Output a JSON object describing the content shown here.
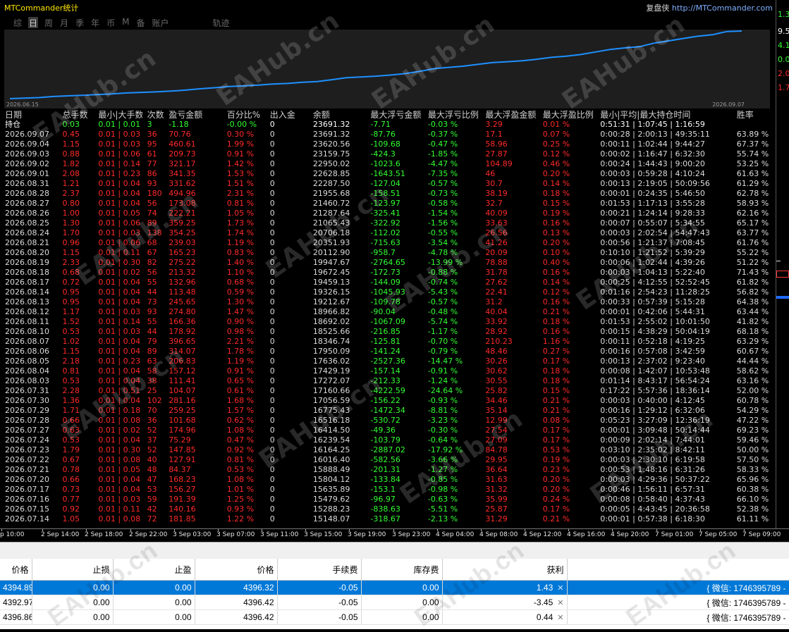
{
  "indicator": {
    "title": "MTCommander统计",
    "brand_prefix": "复盘侠",
    "brand_url": "http://MTCommander.com"
  },
  "tabs": [
    {
      "label": "综",
      "active": false
    },
    {
      "label": "日",
      "active": true
    },
    {
      "label": "周",
      "active": false
    },
    {
      "label": "月",
      "active": false
    },
    {
      "label": "季",
      "active": false
    },
    {
      "label": "年",
      "active": false
    },
    {
      "label": "币",
      "active": false
    },
    {
      "label": "M",
      "active": false
    },
    {
      "label": "备",
      "active": false
    },
    {
      "label": "账户",
      "active": false
    },
    {
      "label": "轨迹",
      "active": false
    }
  ],
  "equity": {
    "start_date": "2026.06.15",
    "end_date": "2026.09.07",
    "line_color": "#1e90ff",
    "values": [
      14080,
      14150,
      14230,
      14390,
      14480,
      14560,
      14650,
      14760,
      14890,
      14970,
      15040,
      15148,
      15288,
      15479,
      15635,
      15804,
      15888,
      16016,
      16164,
      16239,
      16414,
      16516,
      16775,
      17056,
      17160,
      17272,
      17429,
      17636,
      17950,
      18346,
      18525,
      18692,
      18966,
      19212,
      19326,
      19459,
      19672,
      19947,
      20112,
      20351,
      20706,
      21065,
      21287,
      21460,
      21955,
      22287,
      22628,
      22950,
      23159,
      23620,
      23691
    ]
  },
  "watermark": "EAHub.cn",
  "stats": {
    "headers": [
      "日期",
      "总手数",
      "最小|大手数",
      "次数",
      "盈亏金额",
      "百分比%",
      "出入金",
      "余额",
      "最大浮亏金额",
      "最大浮亏比例",
      "最大浮盈金额",
      "最大浮盈比例",
      "最小|平均|最大持仓时间",
      "胜率"
    ],
    "holding": {
      "label": "持仓",
      "lots": "0.03",
      "minmax": "0.01 | 0.01",
      "count": "3",
      "pnl": "-1.18",
      "pct": "-0.00 %",
      "flow": "0",
      "balance": "23691.32",
      "max_dd": "-7.71",
      "max_dd_pct": "-0.03 %",
      "max_fp": "3.29",
      "max_fp_pct": "0.01 %",
      "hold_time": "0:51:31 | 1:07:45 | 1:16:59",
      "winrate": ""
    },
    "rows": [
      [
        "2026.09.07",
        "0.45",
        "0.01 | 0.03",
        "36",
        "70.76",
        "0.30 %",
        "0",
        "23691.32",
        "-87.76",
        "-0.37 %",
        "17.1",
        "0.07 %",
        "0:00:28 | 2:00:13 | 49:35:11",
        "63.89 %"
      ],
      [
        "2026.09.04",
        "1.15",
        "0.01 | 0.03",
        "95",
        "460.61",
        "1.99 %",
        "0",
        "23620.56",
        "-109.68",
        "-0.47 %",
        "58.96",
        "0.25 %",
        "0:00:11 | 1:02:44 | 9:44:27",
        "67.37 %"
      ],
      [
        "2026.09.03",
        "0.88",
        "0.01 | 0.06",
        "61",
        "209.73",
        "0.91 %",
        "0",
        "23159.75",
        "-424.3",
        "-1.85 %",
        "27.87",
        "0.12 %",
        "0:00:02 | 1:16:47 | 6:32:30",
        "55.74 %"
      ],
      [
        "2026.09.02",
        "1.82",
        "0.01 | 0.14",
        "77",
        "321.17",
        "1.42 %",
        "0",
        "22950.02",
        "-1023.6",
        "-4.47 %",
        "104.89",
        "0.46 %",
        "0:00:24 | 1:44:43 | 9:00:20",
        "53.25 %"
      ],
      [
        "2026.09.01",
        "2.08",
        "0.01 | 0.23",
        "86",
        "341.35",
        "1.53 %",
        "0",
        "22628.85",
        "-1643.51",
        "-7.35 %",
        "46",
        "0.20 %",
        "0:00:03 | 0:59:28 | 4:10:24",
        "61.63 %"
      ],
      [
        "2026.08.31",
        "1.21",
        "0.01 | 0.04",
        "93",
        "331.62",
        "1.51 %",
        "0",
        "22287.50",
        "-127.04",
        "-0.57 %",
        "30.7",
        "0.14 %",
        "0:00:13 | 2:19:05 | 50:09:56",
        "61.29 %"
      ],
      [
        "2026.08.28",
        "2.37",
        "0.01 | 0.04",
        "180",
        "494.96",
        "2.31 %",
        "0",
        "21955.68",
        "-158.51",
        "-0.73 %",
        "38.19",
        "0.18 %",
        "0:00:01 | 0:24:35 | 5:46:50",
        "62.78 %"
      ],
      [
        "2026.08.27",
        "0.80",
        "0.01 | 0.04",
        "56",
        "173.08",
        "0.81 %",
        "0",
        "21460.72",
        "-123.97",
        "-0.58 %",
        "32.7",
        "0.15 %",
        "0:01:53 | 1:17:13 | 3:55:28",
        "58.93 %"
      ],
      [
        "2026.08.26",
        "1.00",
        "0.01 | 0.05",
        "74",
        "222.21",
        "1.05 %",
        "0",
        "21287.64",
        "-325.41",
        "-1.54 %",
        "40.09",
        "0.19 %",
        "0:00:21 | 1:24:14 | 9:28:33",
        "62.16 %"
      ],
      [
        "2026.08.25",
        "1.30",
        "0.01 | 0.06",
        "89",
        "359.25",
        "1.73 %",
        "0",
        "21065.43",
        "-322.92",
        "-1.56 %",
        "33.63",
        "0.16 %",
        "0:00:07 | 0:55:07 | 5:34:55",
        "65.17 %"
      ],
      [
        "2026.08.24",
        "1.70",
        "0.01 | 0.03",
        "138",
        "354.25",
        "1.74 %",
        "0",
        "20706.18",
        "-112.02",
        "-0.55 %",
        "26.56",
        "0.13 %",
        "0:00:03 | 2:02:54 | 54:47:43",
        "63.77 %"
      ],
      [
        "2026.08.21",
        "0.96",
        "0.01 | 0.06",
        "68",
        "239.03",
        "1.19 %",
        "0",
        "20351.93",
        "-715.63",
        "-3.54 %",
        "41.26",
        "0.20 %",
        "0:00:56 | 1:21:37 | 7:08:45",
        "61.76 %"
      ],
      [
        "2026.08.20",
        "1.15",
        "0.01 | 0.11",
        "67",
        "165.23",
        "0.83 %",
        "0",
        "20112.90",
        "-958.7",
        "-4.78 %",
        "20.09",
        "0.10 %",
        "0:10:10 | 1:21:52 | 5:39:29",
        "55.22 %"
      ],
      [
        "2026.08.19",
        "2.33",
        "0.01 | 0.30",
        "82",
        "275.22",
        "1.40 %",
        "0",
        "19947.67",
        "-2764.65",
        "-13.99 %",
        "78.88",
        "0.40 %",
        "0:00:06 | 1:02:44 | 4:39:26",
        "51.22 %"
      ],
      [
        "2026.08.18",
        "0.68",
        "0.01 | 0.02",
        "56",
        "213.32",
        "1.10 %",
        "0",
        "19672.45",
        "-172.73",
        "-0.88 %",
        "31.78",
        "0.16 %",
        "0:00:03 | 1:04:13 | 5:22:40",
        "71.43 %"
      ],
      [
        "2026.08.17",
        "0.72",
        "0.01 | 0.04",
        "55",
        "132.96",
        "0.68 %",
        "0",
        "19459.13",
        "-144.09",
        "-0.74 %",
        "27.62",
        "0.14 %",
        "0:00:25 | 4:12:55 | 52:52:45",
        "61.82 %"
      ],
      [
        "2026.08.14",
        "0.95",
        "0.01 | 0.04",
        "44",
        "113.48",
        "0.59 %",
        "0",
        "19326.15",
        "-1045.93",
        "-5.43 %",
        "22.41",
        "0.12 %",
        "0:01:16 | 2:54:23 | 11:28:25",
        "56.82 %"
      ],
      [
        "2026.08.13",
        "0.95",
        "0.01 | 0.04",
        "73",
        "245.65",
        "1.30 %",
        "0",
        "19212.67",
        "-109.78",
        "-0.57 %",
        "31.2",
        "0.16 %",
        "0:00:33 | 0:57:39 | 5:15:28",
        "64.38 %"
      ],
      [
        "2026.08.12",
        "1.17",
        "0.01 | 0.03",
        "93",
        "274.80",
        "1.47 %",
        "0",
        "18966.82",
        "-90.04",
        "-0.48 %",
        "40.04",
        "0.21 %",
        "0:00:01 | 0:42:06 | 5:44:31",
        "63.44 %"
      ],
      [
        "2026.08.11",
        "1.52",
        "0.01 | 0.14",
        "55",
        "166.36",
        "0.90 %",
        "0",
        "18692.02",
        "-1067.09",
        "-5.74 %",
        "33.92",
        "0.18 %",
        "0:01:53 | 2:55:02 | 10:01:50",
        "41.82 %"
      ],
      [
        "2026.08.10",
        "0.53",
        "0.01 | 0.03",
        "44",
        "178.92",
        "0.98 %",
        "0",
        "18525.66",
        "-216.85",
        "-1.17 %",
        "28.92",
        "0.16 %",
        "0:00:15 | 4:38:29 | 50:04:19",
        "68.18 %"
      ],
      [
        "2026.08.07",
        "1.02",
        "0.01 | 0.04",
        "79",
        "396.65",
        "2.21 %",
        "0",
        "18346.74",
        "-125.81",
        "-0.70 %",
        "210.23",
        "1.16 %",
        "0:00:11 | 0:52:18 | 4:19:25",
        "63.29 %"
      ],
      [
        "2026.08.06",
        "1.15",
        "0.01 | 0.04",
        "89",
        "314.07",
        "1.78 %",
        "0",
        "17950.09",
        "-141.24",
        "-0.79 %",
        "48.46",
        "0.27 %",
        "0:00:16 | 0:57:08 | 3:42:59",
        "60.67 %"
      ],
      [
        "2026.08.05",
        "2.18",
        "0.01 | 0.23",
        "63",
        "206.83",
        "1.19 %",
        "0",
        "17636.02",
        "-2527.36",
        "-14.47 %",
        "30.26",
        "0.17 %",
        "0:00:13 | 2:37:02 | 9:23:40",
        "44.44 %"
      ],
      [
        "2026.08.04",
        "0.81",
        "0.01 | 0.04",
        "58",
        "157.12",
        "0.91 %",
        "0",
        "17429.19",
        "-157.14",
        "-0.91 %",
        "30.62",
        "0.18 %",
        "0:00:08 | 1:42:07 | 10:53:48",
        "58.62 %"
      ],
      [
        "2026.08.03",
        "0.53",
        "0.01 | 0.04",
        "38",
        "111.41",
        "0.65 %",
        "0",
        "17272.07",
        "-212.33",
        "-1.24 %",
        "30.55",
        "0.18 %",
        "0:01:14 | 8:43:17 | 56:54:24",
        "63.16 %"
      ],
      [
        "2026.07.31",
        "2.28",
        "0.01 | 0.51",
        "25",
        "104.07",
        "0.61 %",
        "0",
        "17160.66",
        "-4222.59",
        "-24.64 %",
        "25.82",
        "0.15 %",
        "0:17:22 | 5:57:36 | 18:36:14",
        "52.00 %"
      ],
      [
        "2026.07.30",
        "1.36",
        "0.01 | 0.04",
        "102",
        "281.16",
        "1.68 %",
        "0",
        "17056.59",
        "-156.22",
        "-0.93 %",
        "34.46",
        "0.21 %",
        "0:00:03 | 0:40:00 | 4:12:45",
        "60.78 %"
      ],
      [
        "2026.07.29",
        "1.71",
        "0.01 | 0.18",
        "70",
        "259.25",
        "1.57 %",
        "0",
        "16775.43",
        "-1472.34",
        "-8.81 %",
        "35.14",
        "0.21 %",
        "0:00:16 | 1:29:12 | 6:32:06",
        "54.29 %"
      ],
      [
        "2026.07.28",
        "0.66",
        "0.01 | 0.08",
        "36",
        "101.68",
        "0.62 %",
        "0",
        "16516.18",
        "-530.72",
        "-3.23 %",
        "12.99",
        "0.08 %",
        "0:05:23 | 3:27:09 | 12:36:19",
        "47.22 %"
      ],
      [
        "2026.07.27",
        "0.63",
        "0.01 | 0.02",
        "52",
        "174.96",
        "1.08 %",
        "0",
        "16414.50",
        "-49.36",
        "-0.30 %",
        "27.54",
        "0.17 %",
        "0:00:01 | 3:09:48 | 50:14:44",
        "69.23 %"
      ],
      [
        "2026.07.24",
        "0.53",
        "0.01 | 0.04",
        "37",
        "75.29",
        "0.47 %",
        "0",
        "16239.54",
        "-103.79",
        "-0.64 %",
        "27.09",
        "0.17 %",
        "0:00:09 | 2:02:14 | 7:44:01",
        "59.46 %"
      ],
      [
        "2026.07.23",
        "1.79",
        "0.01 | 0.30",
        "52",
        "147.85",
        "0.92 %",
        "0",
        "16164.25",
        "-2887.02",
        "-17.92 %",
        "84.78",
        "0.53 %",
        "0:03:10 | 2:35:02 | 8:42:11",
        "50.00 %"
      ],
      [
        "2026.07.22",
        "0.67",
        "0.01 | 0.08",
        "40",
        "127.91",
        "0.81 %",
        "0",
        "16016.40",
        "-582.56",
        "-3.66 %",
        "29.95",
        "0.19 %",
        "0:00:03 | 2:30:10 | 6:19:58",
        "57.50 %"
      ],
      [
        "2026.07.21",
        "0.78",
        "0.01 | 0.05",
        "48",
        "84.37",
        "0.53 %",
        "0",
        "15888.49",
        "-201.31",
        "-1.27 %",
        "36.64",
        "0.23 %",
        "0:00:53 | 1:48:16 | 6:31:26",
        "58.33 %"
      ],
      [
        "2026.07.20",
        "0.66",
        "0.01 | 0.04",
        "47",
        "168.23",
        "1.08 %",
        "0",
        "15804.12",
        "-133.84",
        "-0.85 %",
        "31.63",
        "0.20 %",
        "0:00:03 | 4:29:36 | 50:37:22",
        "65.96 %"
      ],
      [
        "2026.07.17",
        "0.73",
        "0.01 | 0.04",
        "53",
        "156.27",
        "1.01 %",
        "0",
        "15635.89",
        "-153.1",
        "-0.98 %",
        "31.32",
        "0.20 %",
        "0:00:46 | 1:56:11 | 6:57:31",
        "60.38 %"
      ],
      [
        "2026.07.16",
        "0.77",
        "0.01 | 0.03",
        "59",
        "191.39",
        "1.25 %",
        "0",
        "15479.62",
        "-96.97",
        "-0.63 %",
        "35.99",
        "0.24 %",
        "0:00:08 | 0:58:40 | 4:37:43",
        "66.10 %"
      ],
      [
        "2026.07.15",
        "0.92",
        "0.01 | 0.11",
        "42",
        "140.16",
        "0.93 %",
        "0",
        "15288.23",
        "-838.63",
        "-5.51 %",
        "25.87",
        "0.17 %",
        "0:00:05 | 4:43:45 | 20:36:58",
        "52.38 %"
      ],
      [
        "2026.07.14",
        "1.05",
        "0.01 | 0.08",
        "72",
        "181.85",
        "1.22 %",
        "0",
        "15148.07",
        "-318.67",
        "-2.13 %",
        "31.29",
        "0.21 %",
        "0:00:01 | 0:57:38 | 6:18:30",
        "61.11 %"
      ]
    ]
  },
  "right_axis": [
    {
      "label": "1.3",
      "color": "#33ff33"
    },
    {
      "label": "9.5",
      "color": "#ffffff"
    },
    {
      "label": "4.1",
      "color": "#33ff33"
    },
    {
      "label": "0.0",
      "color": "#33ff33"
    },
    {
      "label": "2.0",
      "color": "#ff2a2a"
    },
    {
      "label": "1.7",
      "color": "#ff2a2a"
    }
  ],
  "time_axis": [
    "p 10:00",
    "2 Sep 14:00",
    "2 Sep 18:00",
    "2 Sep 22:00",
    "3 Sep 03:00",
    "3 Sep 07:00",
    "3 Sep 11:00",
    "3 Sep 15:00",
    "3 Sep 19:00",
    "3 Sep 23:00",
    "4 Sep 04:00",
    "4 Sep 08:00",
    "4 Sep 12:00",
    "4 Sep 16:00",
    "4 Sep 20:00",
    "7 Sep 01:00",
    "7 Sep 05:00",
    "7 Sep 09:00"
  ],
  "orders": {
    "headers": [
      "价格",
      "止损",
      "止盈",
      "价格",
      "手续费",
      "库存费",
      "获利",
      ""
    ],
    "rows": [
      {
        "open": "4394.89",
        "sl": "0.00",
        "tp": "0.00",
        "price": "4396.32",
        "commission": "-0.05",
        "swap": "0.00",
        "profit": "1.43",
        "comment": "{ 微信: 1746395789 -",
        "selected": true
      },
      {
        "open": "4392.97",
        "sl": "0.00",
        "tp": "0.00",
        "price": "4396.42",
        "commission": "-0.05",
        "swap": "0.00",
        "profit": "-3.45",
        "comment": "{ 微信: 1746395789 -",
        "selected": false
      },
      {
        "open": "4396.86",
        "sl": "0.00",
        "tp": "0.00",
        "price": "4396.42",
        "commission": "-0.05",
        "swap": "0.00",
        "profit": "0.44",
        "comment": "{ 微信: 1746395789 -",
        "selected": false
      }
    ]
  }
}
